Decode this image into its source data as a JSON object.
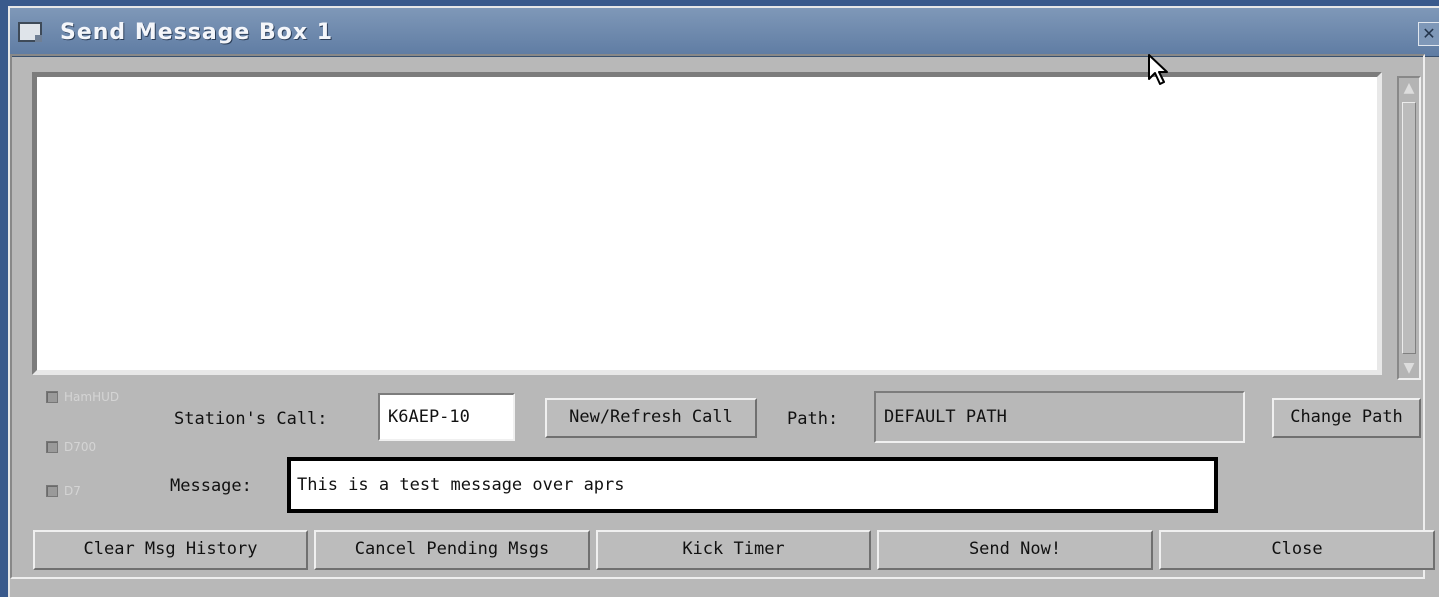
{
  "window": {
    "title": "Send Message Box 1",
    "close_glyph": "✕"
  },
  "scrollbar": {
    "up_arrow": "▲",
    "down_arrow": "▼"
  },
  "options": {
    "hamhud": "HamHUD",
    "d700": "D700",
    "d7": "D7"
  },
  "form": {
    "station_call_label": "Station's Call:",
    "station_call_value": "K6AEP-10",
    "new_refresh_label": "New/Refresh Call",
    "path_label": "Path:",
    "path_value": "DEFAULT PATH",
    "change_path_label": "Change Path",
    "message_label": "Message:",
    "message_value": "This is a test message over aprs"
  },
  "buttons": {
    "clear_history": "Clear Msg History",
    "cancel_pending": "Cancel Pending Msgs",
    "kick_timer": "Kick Timer",
    "send_now": "Send Now!",
    "close": "Close"
  },
  "icons": {
    "window_icon": "window-icon",
    "close_icon": "close-icon",
    "mouse_cursor": "arrow-cursor-icon"
  }
}
